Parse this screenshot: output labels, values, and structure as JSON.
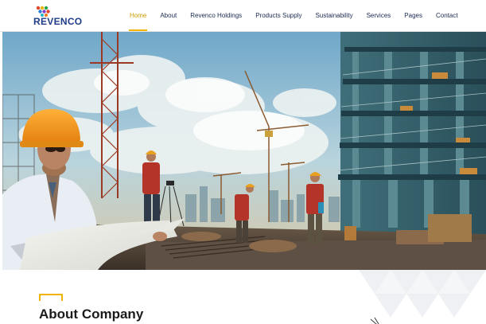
{
  "brand": {
    "name": "REVENCO"
  },
  "nav": {
    "items": [
      {
        "label": "Home",
        "active": true
      },
      {
        "label": "About",
        "active": false
      },
      {
        "label": "Revenco Holdings",
        "active": false
      },
      {
        "label": "Products Supply",
        "active": false
      },
      {
        "label": "Sustainability",
        "active": false
      },
      {
        "label": "Services",
        "active": false
      },
      {
        "label": "Pages",
        "active": false
      },
      {
        "label": "Contact",
        "active": false
      }
    ]
  },
  "hero": {
    "image": "construction-site-photo"
  },
  "about": {
    "title": "About Company"
  },
  "colors": {
    "accent": "#f0b400",
    "nav_text": "#1b2a52",
    "brand_text": "#1f3c88"
  }
}
